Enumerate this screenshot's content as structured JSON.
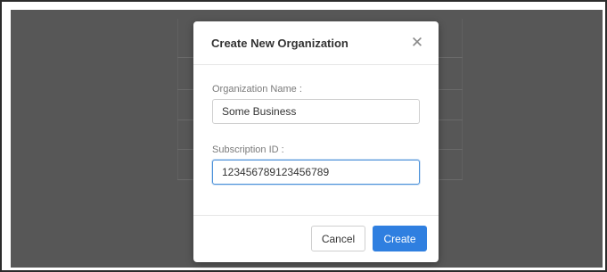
{
  "modal": {
    "title": "Create New Organization",
    "close_glyph": "✕",
    "close_icon": "close-icon"
  },
  "form": {
    "org_name_label": "Organization Name :",
    "org_name_value": "Some Business",
    "subscription_label": "Subscription ID :",
    "subscription_value": "123456789123456789"
  },
  "footer": {
    "cancel_label": "Cancel",
    "create_label": "Create"
  },
  "colors": {
    "backdrop": "#575757",
    "primary": "#2f7fe0",
    "focus_border": "#4a90d9"
  }
}
